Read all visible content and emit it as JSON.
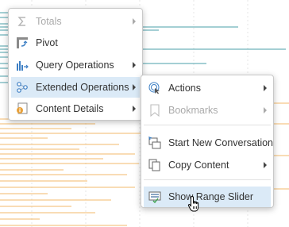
{
  "main_menu": {
    "items": [
      {
        "label": "Totals",
        "icon": "sigma-icon",
        "disabled": true,
        "submenu": true
      },
      {
        "label": "Pivot",
        "icon": "pivot-icon",
        "disabled": false,
        "submenu": false
      },
      {
        "label": "Query Operations",
        "icon": "query-operations-icon",
        "disabled": false,
        "submenu": true
      },
      {
        "label": "Extended Operations",
        "icon": "extended-operations-icon",
        "disabled": false,
        "submenu": true,
        "highlighted": true
      },
      {
        "label": "Content Details",
        "icon": "content-details-icon",
        "disabled": false,
        "submenu": true
      }
    ]
  },
  "sub_menu": {
    "items": [
      {
        "label": "Actions",
        "icon": "actions-icon",
        "disabled": false,
        "submenu": true
      },
      {
        "label": "Bookmarks",
        "icon": "bookmark-icon",
        "disabled": true,
        "submenu": true
      },
      {
        "label": "Start New Conversation",
        "icon": "new-conversation-icon",
        "disabled": false,
        "submenu": false
      },
      {
        "label": "Copy Content",
        "icon": "copy-icon",
        "disabled": false,
        "submenu": true
      },
      {
        "label": "Show Range Slider",
        "icon": "range-slider-icon",
        "disabled": false,
        "submenu": false,
        "highlighted": true
      }
    ]
  },
  "colors": {
    "highlight": "#dbeaf7",
    "chart_teal": "#2a8f9a",
    "chart_orange": "#f0a43a",
    "icon_blue": "#3d7fc4",
    "icon_orange": "#e8a13a"
  }
}
